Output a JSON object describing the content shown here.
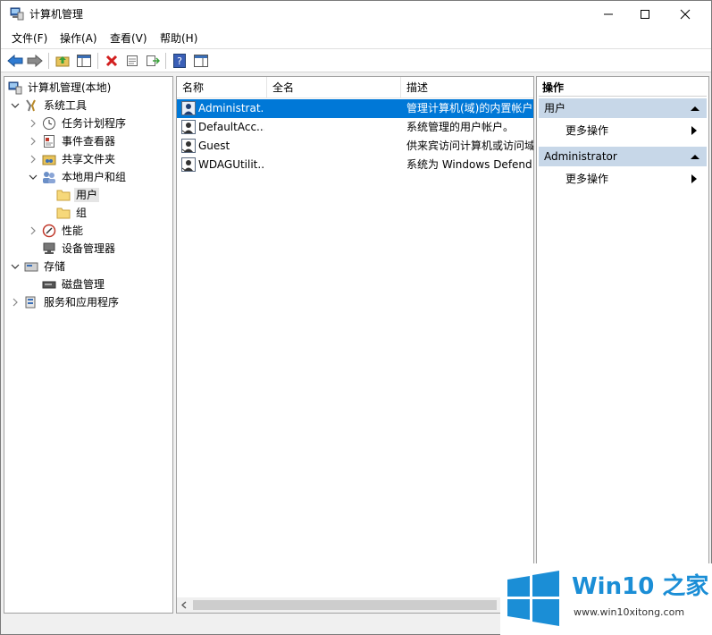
{
  "window": {
    "title": "计算机管理"
  },
  "menu": [
    {
      "label": "文件(F)"
    },
    {
      "label": "操作(A)"
    },
    {
      "label": "查看(V)"
    },
    {
      "label": "帮助(H)"
    }
  ],
  "tree": {
    "root": "计算机管理(本地)",
    "items": [
      {
        "label": "系统工具"
      },
      {
        "label": "任务计划程序"
      },
      {
        "label": "事件查看器"
      },
      {
        "label": "共享文件夹"
      },
      {
        "label": "本地用户和组"
      },
      {
        "label": "用户"
      },
      {
        "label": "组"
      },
      {
        "label": "性能"
      },
      {
        "label": "设备管理器"
      },
      {
        "label": "存储"
      },
      {
        "label": "磁盘管理"
      },
      {
        "label": "服务和应用程序"
      }
    ]
  },
  "list": {
    "columns": [
      "名称",
      "全名",
      "描述"
    ],
    "rows": [
      {
        "name": "Administrat...",
        "fullname": "",
        "desc": "管理计算机(域)的内置帐户"
      },
      {
        "name": "DefaultAcc...",
        "fullname": "",
        "desc": "系统管理的用户帐户。"
      },
      {
        "name": "Guest",
        "fullname": "",
        "desc": "供来宾访问计算机或访问域"
      },
      {
        "name": "WDAGUtilit...",
        "fullname": "",
        "desc": "系统为 Windows Defend"
      }
    ]
  },
  "actions": {
    "title": "操作",
    "sections": [
      {
        "header": "用户",
        "item": "更多操作"
      },
      {
        "header": "Administrator",
        "item": "更多操作"
      }
    ]
  },
  "watermark": {
    "brand": "Win10",
    "brand_suffix": "之家",
    "url": "www.win10xitong.com"
  },
  "colors": {
    "selection": "#0078d7",
    "action_header": "#c7d7e8",
    "logo_blue": "#1b8ed6"
  }
}
